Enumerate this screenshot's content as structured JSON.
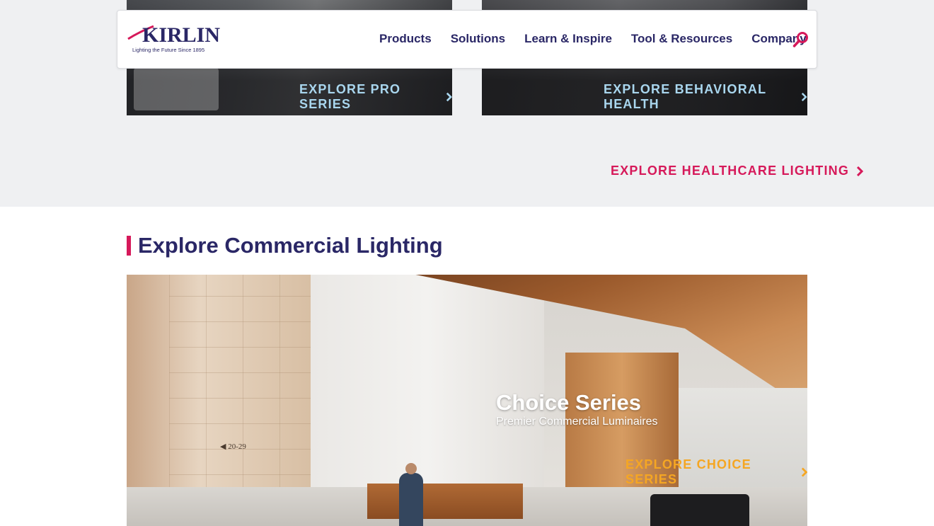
{
  "header": {
    "logo_text": "KIRLIN",
    "logo_tagline": "Lighting the Future Since 1895",
    "nav": [
      "Products",
      "Solutions",
      "Learn & Inspire",
      "Tool & Resources",
      "Company"
    ],
    "search_icon": "search-icon"
  },
  "cards": {
    "pro_series_cta": "EXPLORE PRO SERIES",
    "behavioral_health_cta": "EXPLORE BEHAVIORAL HEALTH"
  },
  "healthcare": {
    "cta": "EXPLORE HEALTHCARE LIGHTING"
  },
  "commercial": {
    "section_title": "Explore Commercial Lighting",
    "hero": {
      "title": "Choice Series",
      "subtitle": "Premier Commercial Luminaires",
      "cta": "EXPLORE CHOICE SERIES",
      "sign_text": "◀ 20-29"
    }
  },
  "colors": {
    "brand_navy": "#2a2766",
    "accent_pink": "#d6195a",
    "accent_orange": "#f5a623",
    "cta_light_blue": "#a9d6ee"
  }
}
